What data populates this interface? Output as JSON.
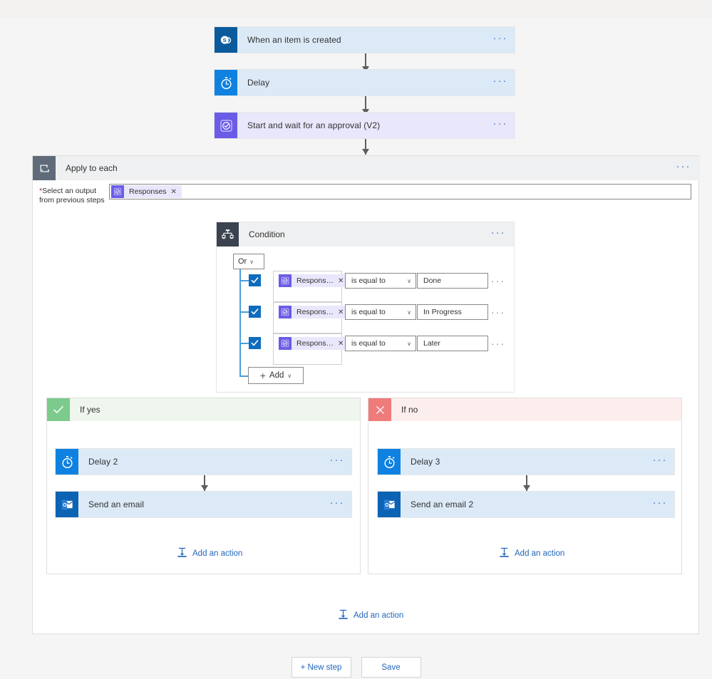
{
  "flow": {
    "steps": [
      {
        "name": "trigger",
        "title": "When an item is created",
        "icon": "sharepoint-icon",
        "ellipsis": "···"
      },
      {
        "name": "delay",
        "title": "Delay",
        "icon": "stopwatch-icon",
        "ellipsis": "···"
      },
      {
        "name": "approval",
        "title": "Start and wait for an approval (V2)",
        "icon": "approvals-icon",
        "ellipsis": "···"
      }
    ]
  },
  "apply_to_each": {
    "title": "Apply to each",
    "icon": "loop-icon",
    "ellipsis": "···",
    "field_label_required": "*",
    "field_label_line1": "Select an output",
    "field_label_line2": "from previous steps",
    "token": {
      "label": "Responses",
      "remove": "✕",
      "icon": "approvals-token-icon"
    }
  },
  "condition": {
    "title": "Condition",
    "icon": "condition-icon",
    "ellipsis": "···",
    "operator": {
      "label": "Or",
      "chevron": "∨"
    },
    "rows": [
      {
        "checkbox": "✓",
        "token": "Respons…",
        "token_remove": "✕",
        "operator": "is equal to",
        "chevron": "∨",
        "value": "Done",
        "ellipsis": "···"
      },
      {
        "checkbox": "✓",
        "token": "Respons…",
        "token_remove": "✕",
        "operator": "is equal to",
        "chevron": "∨",
        "value": "In Progress",
        "ellipsis": "···"
      },
      {
        "checkbox": "✓",
        "token": "Respons…",
        "token_remove": "✕",
        "operator": "is equal to",
        "chevron": "∨",
        "value": "Later",
        "ellipsis": "···"
      }
    ],
    "add_button": {
      "plus": "+",
      "label": "Add",
      "chevron": "∨"
    }
  },
  "branches": {
    "yes": {
      "title": "If yes",
      "icon": "check-icon",
      "steps": [
        {
          "title": "Delay 2",
          "icon": "stopwatch-icon",
          "ellipsis": "···"
        },
        {
          "title": "Send an email",
          "icon": "outlook-icon",
          "ellipsis": "···"
        }
      ],
      "add_action": "Add an action"
    },
    "no": {
      "title": "If no",
      "icon": "x-icon",
      "steps": [
        {
          "title": "Delay 3",
          "icon": "stopwatch-icon",
          "ellipsis": "···"
        },
        {
          "title": "Send an email 2",
          "icon": "outlook-icon",
          "ellipsis": "···"
        }
      ],
      "add_action": "Add an action"
    }
  },
  "loop_add_action": "Add an action",
  "footer": {
    "new_step": "+ New step",
    "save": "Save"
  },
  "colors": {
    "accent_blue": "#0f6cbd",
    "card_blue": "#dceaf7",
    "card_purple": "#e9e7fb",
    "yes_green": "#7ccb8c",
    "no_red": "#ef7b7b",
    "connector": "#4a9fdb"
  }
}
